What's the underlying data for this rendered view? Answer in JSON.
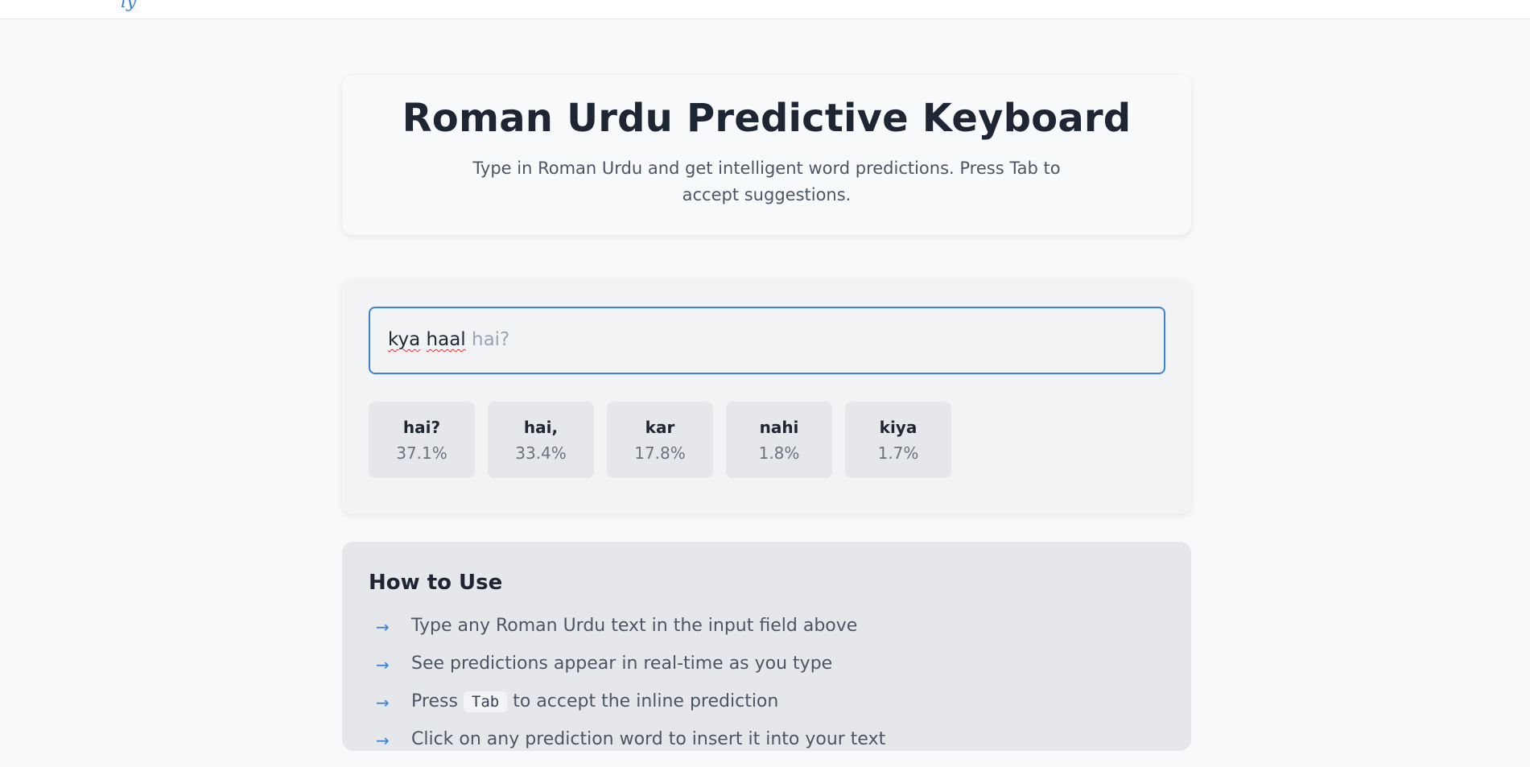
{
  "header": {
    "title": "Roman Urdu Predictive Keyboard",
    "subtitle": "Type in Roman Urdu and get intelligent word predictions. Press Tab to accept suggestions."
  },
  "editor": {
    "typed_word_1": "kya",
    "typed_word_2": "haal",
    "inline_prediction": "hai?"
  },
  "predictions": [
    {
      "word": "hai?",
      "percent": "37.1%"
    },
    {
      "word": "hai,",
      "percent": "33.4%"
    },
    {
      "word": "kar",
      "percent": "17.8%"
    },
    {
      "word": "nahi",
      "percent": "1.8%"
    },
    {
      "word": "kiya",
      "percent": "1.7%"
    }
  ],
  "help": {
    "title": "How to Use",
    "items": [
      "Type any Roman Urdu text in the input field above",
      "See predictions appear in real-time as you type"
    ],
    "tab_item": {
      "before": "Press",
      "key": "Tab",
      "after": "to accept the inline prediction"
    },
    "partial_item": "Click on any prediction word to insert it into your text"
  },
  "colors": {
    "accent": "#3b82d6",
    "misspell_underline": "#e03131"
  },
  "icons": {
    "list_bullet": "arrow-right-icon",
    "arrow_glyph": "→"
  }
}
